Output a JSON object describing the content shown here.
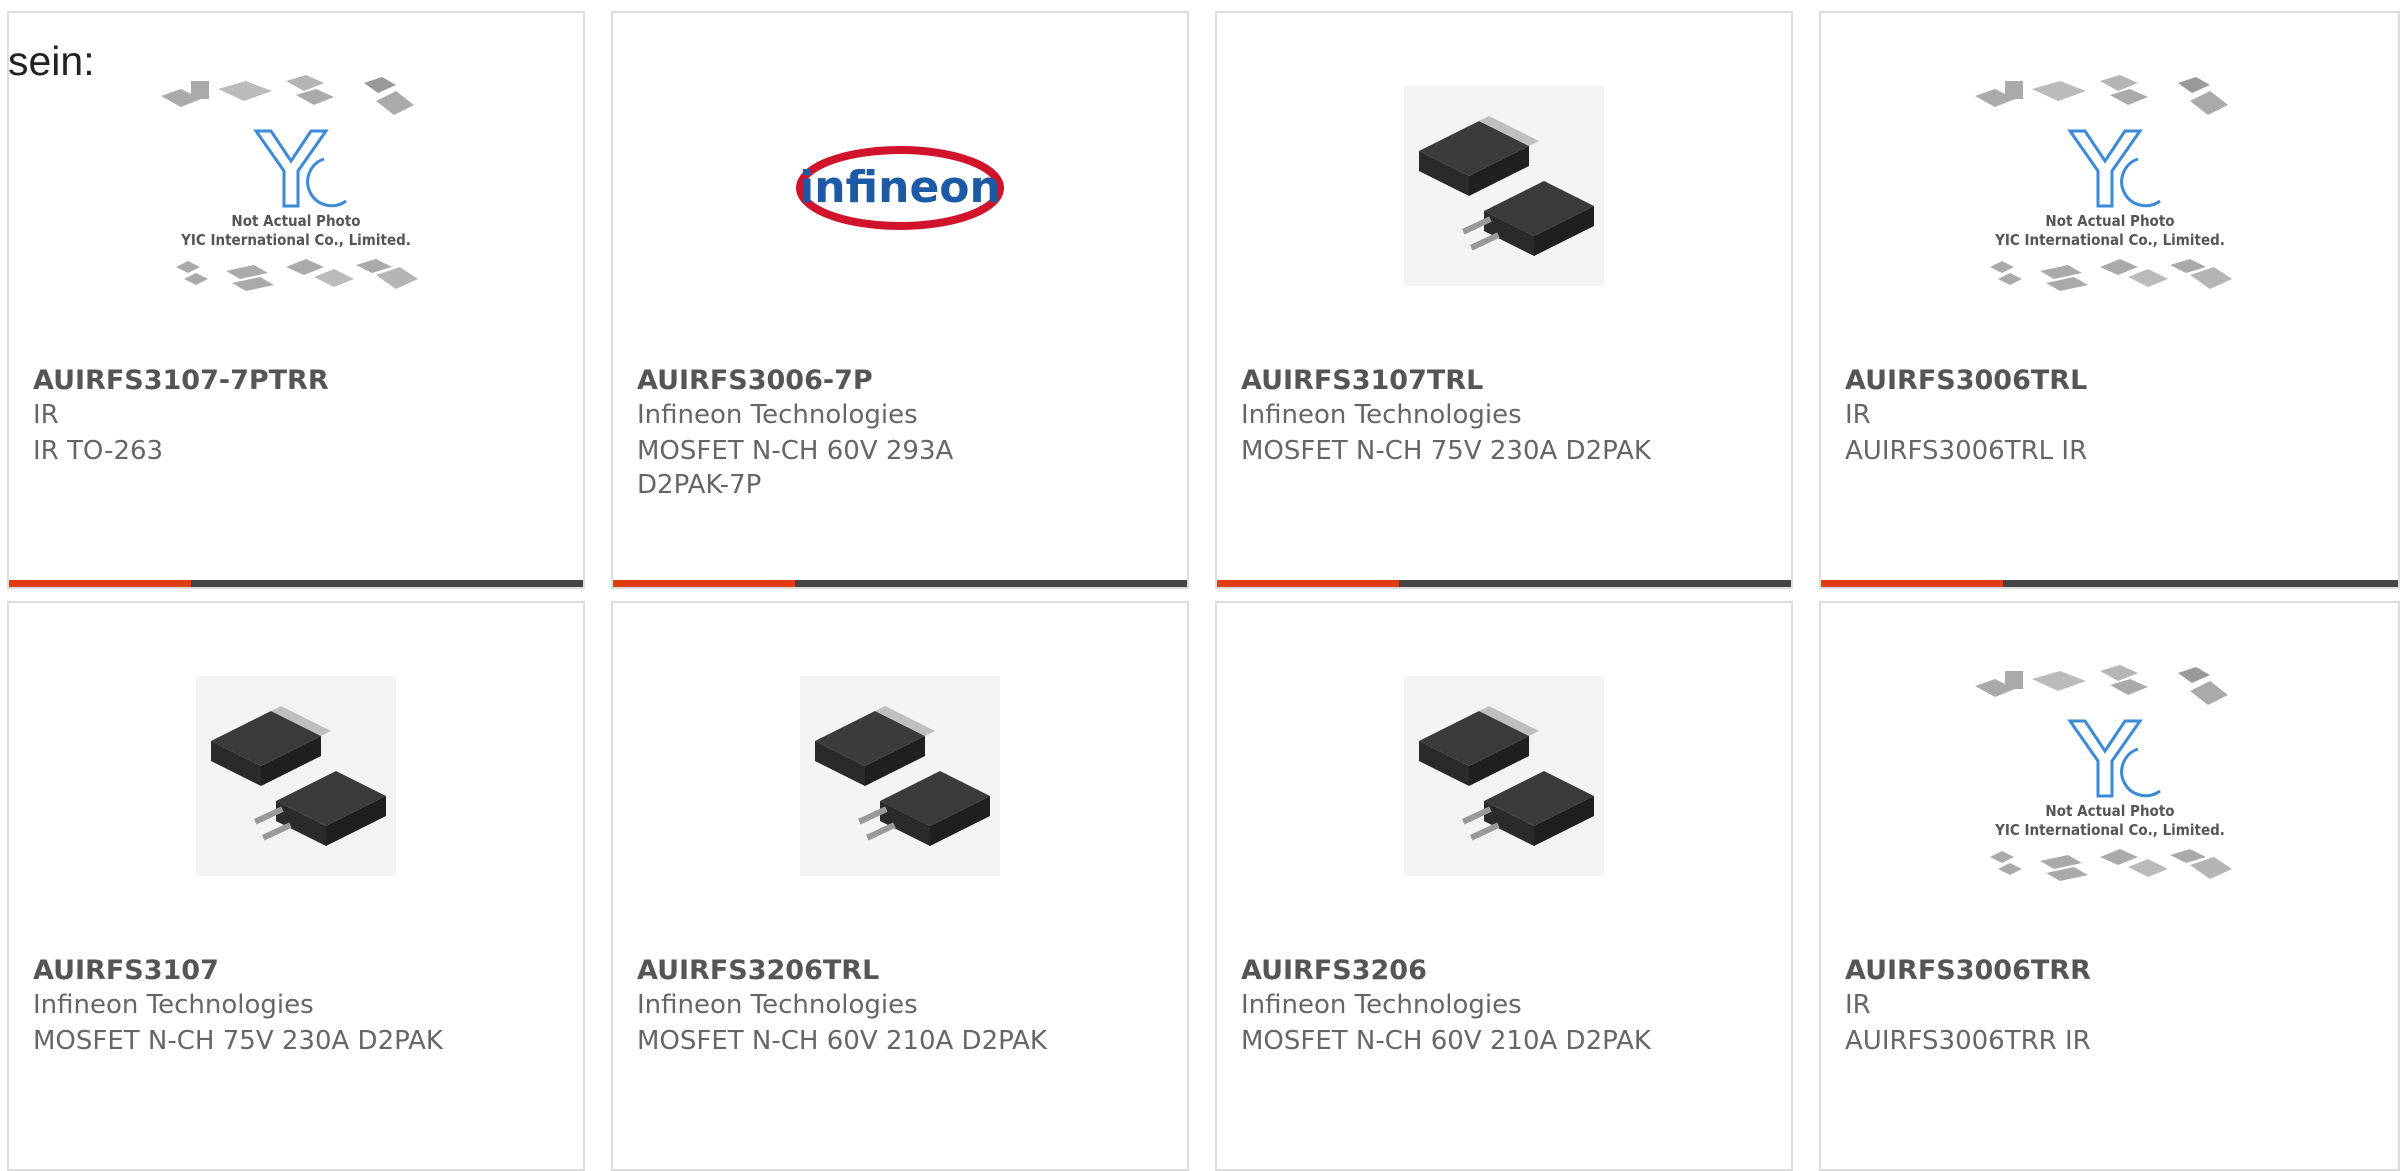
{
  "intro_text": "sein:",
  "placeholder_caption_1": "Not Actual Photo",
  "placeholder_caption_2": "YIC International Co., Limited.",
  "infineon_logo_text": "infineon",
  "colors": {
    "accent": "#e03e12",
    "bar": "#444444",
    "border": "#dcdcdc",
    "text": "#555555"
  },
  "cards": [
    {
      "part": "AUIRFS3107-7PTRR",
      "maker": "IR",
      "desc": "IR TO-263",
      "image": "yic-placeholder",
      "accent_bar": true
    },
    {
      "part": "AUIRFS3006-7P",
      "maker": "Infineon Technologies",
      "desc": "MOSFET N-CH 60V 293A D2PAK-7P",
      "image": "infineon-logo",
      "accent_bar": true
    },
    {
      "part": "AUIRFS3107TRL",
      "maker": "Infineon Technologies",
      "desc": "MOSFET N-CH 75V 230A D2PAK",
      "image": "d2pak-package",
      "accent_bar": true
    },
    {
      "part": "AUIRFS3006TRL",
      "maker": "IR",
      "desc": "AUIRFS3006TRL IR",
      "image": "yic-placeholder",
      "accent_bar": true
    },
    {
      "part": "AUIRFS3107",
      "maker": "Infineon Technologies",
      "desc": "MOSFET N-CH 75V 230A D2PAK",
      "image": "d2pak-package",
      "accent_bar": false
    },
    {
      "part": "AUIRFS3206TRL",
      "maker": "Infineon Technologies",
      "desc": "MOSFET N-CH 60V 210A D2PAK",
      "image": "d2pak-package",
      "accent_bar": false
    },
    {
      "part": "AUIRFS3206",
      "maker": "Infineon Technologies",
      "desc": "MOSFET N-CH 60V 210A D2PAK",
      "image": "d2pak-package",
      "accent_bar": false
    },
    {
      "part": "AUIRFS3006TRR",
      "maker": "IR",
      "desc": "AUIRFS3006TRR IR",
      "image": "yic-placeholder",
      "accent_bar": false
    }
  ]
}
